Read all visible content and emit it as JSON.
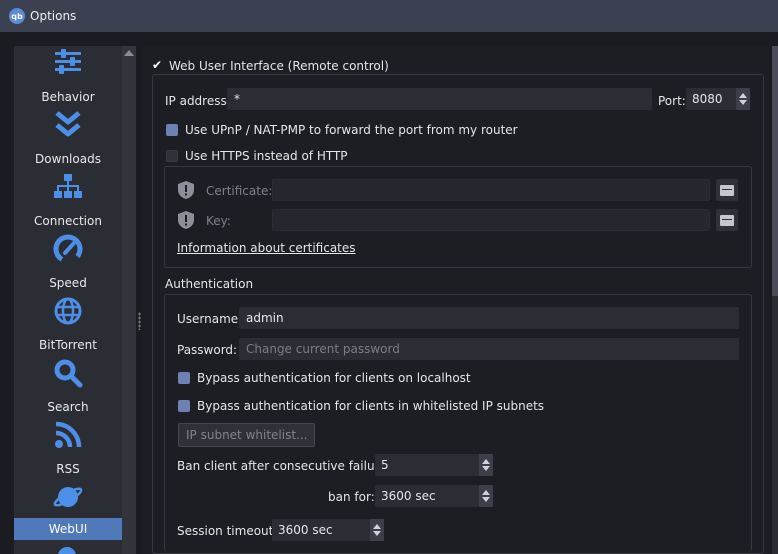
{
  "window": {
    "title": "Options",
    "app_badge": "qb"
  },
  "sidebar": {
    "items": [
      {
        "label": "Behavior",
        "icon": "sliders-icon"
      },
      {
        "label": "Downloads",
        "icon": "double-chevron-down-icon"
      },
      {
        "label": "Connection",
        "icon": "network-icon"
      },
      {
        "label": "Speed",
        "icon": "speedometer-icon"
      },
      {
        "label": "BitTorrent",
        "icon": "globe-icon"
      },
      {
        "label": "Search",
        "icon": "magnifier-icon"
      },
      {
        "label": "RSS",
        "icon": "rss-icon"
      },
      {
        "label": "WebUI",
        "icon": "planet-icon",
        "active": true
      }
    ],
    "accent_color": "#4f79b8"
  },
  "webui": {
    "enable_label": "Web User Interface (Remote control)",
    "enable_checked": true,
    "ip_label": "IP address:",
    "ip_value": "*",
    "port_label": "Port:",
    "port_value": "8080",
    "upnp_label": "Use UPnP / NAT-PMP to forward the port from my router",
    "upnp_checked": true,
    "https_label": "Use HTTPS instead of HTTP",
    "https_checked": false,
    "certificate_label": "Certificate:",
    "key_label": "Key:",
    "cert_info_link": "Information about certificates"
  },
  "auth": {
    "section_title": "Authentication",
    "username_label": "Username:",
    "username_value": "admin",
    "password_label": "Password:",
    "password_placeholder": "Change current password",
    "bypass_localhost_label": "Bypass authentication for clients on localhost",
    "bypass_localhost_checked": true,
    "bypass_whitelist_label": "Bypass authentication for clients in whitelisted IP subnets",
    "bypass_whitelist_checked": true,
    "whitelist_button": "IP subnet whitelist...",
    "ban_label": "Ban client after consecutive failures:",
    "ban_value": "5",
    "ban_for_label": "ban for:",
    "ban_for_value": "3600 sec",
    "session_timeout_label": "Session timeout:",
    "session_timeout_value": "3600 sec"
  }
}
